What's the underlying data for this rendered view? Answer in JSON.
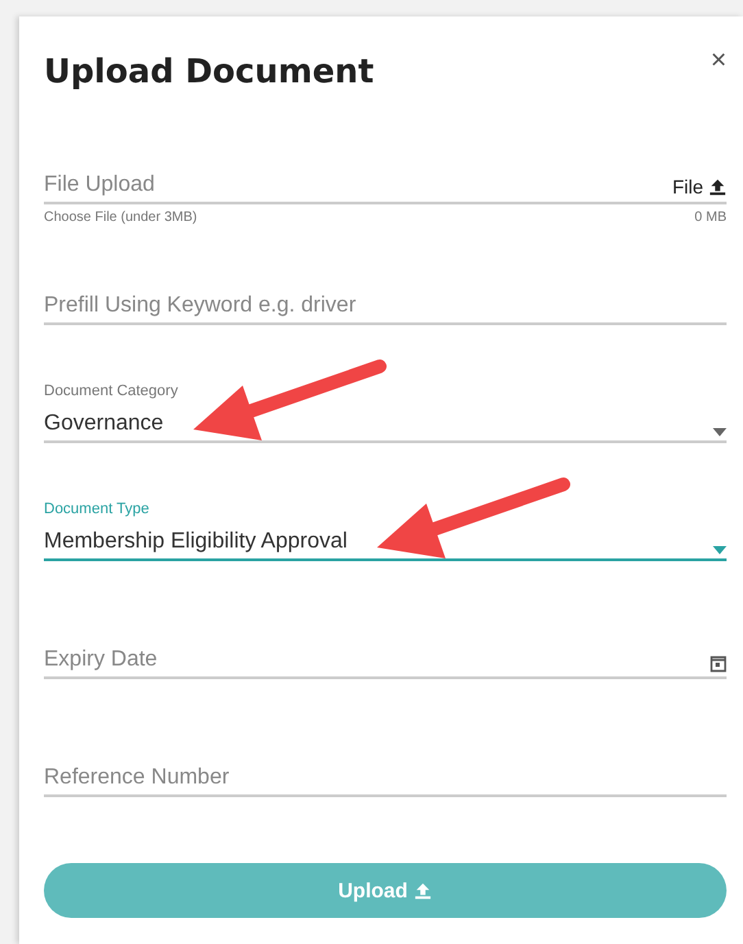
{
  "dialog": {
    "title": "Upload Document",
    "close": "×"
  },
  "fields": [
    {
      "kind": "file",
      "placeholder": "File Upload",
      "action": "File",
      "hint": "Choose File (under 3MB)",
      "size": "0 MB",
      "focused": false,
      "arrow": false
    },
    {
      "kind": "text",
      "placeholder": "Prefill Using Keyword e.g. driver",
      "focused": false,
      "arrow": false
    },
    {
      "kind": "select",
      "label": "Document Category",
      "value": "Governance",
      "focused": false,
      "arrow": true
    },
    {
      "kind": "select",
      "label": "Document Type",
      "value": "Membership Eligibility Approval",
      "focused": true,
      "arrow": true
    },
    {
      "kind": "date",
      "placeholder": "Expiry Date",
      "focused": false,
      "arrow": false
    },
    {
      "kind": "text",
      "placeholder": "Reference Number",
      "focused": false,
      "arrow": false
    }
  ],
  "submit": {
    "label": "Upload"
  }
}
